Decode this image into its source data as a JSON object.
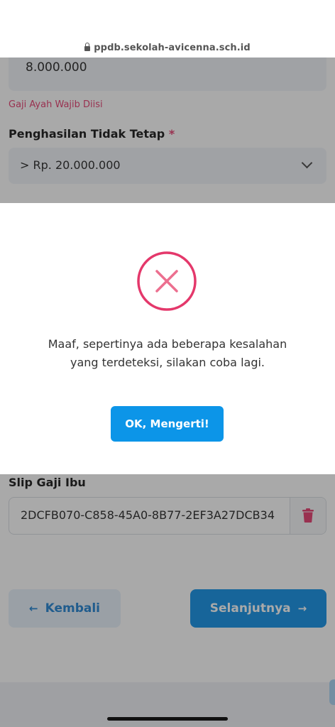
{
  "browser": {
    "url": "ppdb.sekolah-avicenna.sch.id",
    "lock_icon": "lock-icon"
  },
  "form": {
    "income_value": "8.000.000",
    "income_error": "Gaji Ayah Wajib Diisi",
    "irregular_income_label": "Penghasilan Tidak Tetap",
    "required_marker": "*",
    "irregular_income_value": "> Rp. 20.000.000",
    "slip_label": "Slip Gaji Ibu",
    "slip_file_value": "2DCFB070-C858-45A0-8B77-2EF3A27DCB34",
    "back_arrow": "←",
    "back_label": "Kembali",
    "next_label": "Selanjutnya",
    "next_arrow": "→"
  },
  "modal": {
    "line1": "Maaf, sepertinya ada beberapa kesalahan",
    "line2": "yang terdeteksi, silakan coba lagi.",
    "ok_label": "OK, Mengerti!"
  },
  "colors": {
    "error": "#e4386b",
    "primary": "#0c95e8",
    "secondary_bg": "#e6f0fb"
  }
}
